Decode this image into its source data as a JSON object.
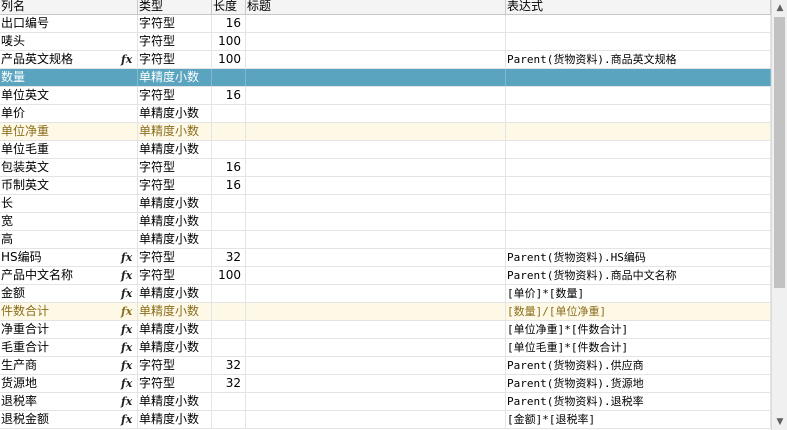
{
  "columns": [
    "列名",
    "类型",
    "长度",
    "标题",
    "表达式"
  ],
  "rows": [
    {
      "name": "出口编号",
      "type": "字符型",
      "length": "16",
      "title": "",
      "expr": "",
      "fx": false,
      "state": ""
    },
    {
      "name": "唛头",
      "type": "字符型",
      "length": "100",
      "title": "",
      "expr": "",
      "fx": false,
      "state": ""
    },
    {
      "name": "产品英文规格",
      "type": "字符型",
      "length": "100",
      "title": "",
      "expr": "Parent(货物资料).商品英文规格",
      "fx": true,
      "state": ""
    },
    {
      "name": "数量",
      "type": "单精度小数",
      "length": "",
      "title": "",
      "expr": "",
      "fx": false,
      "state": "sel"
    },
    {
      "name": "单位英文",
      "type": "字符型",
      "length": "16",
      "title": "",
      "expr": "",
      "fx": false,
      "state": ""
    },
    {
      "name": "单价",
      "type": "单精度小数",
      "length": "",
      "title": "",
      "expr": "",
      "fx": false,
      "state": ""
    },
    {
      "name": "单位净重",
      "type": "单精度小数",
      "length": "",
      "title": "",
      "expr": "",
      "fx": false,
      "state": "alt"
    },
    {
      "name": "单位毛重",
      "type": "单精度小数",
      "length": "",
      "title": "",
      "expr": "",
      "fx": false,
      "state": ""
    },
    {
      "name": "包装英文",
      "type": "字符型",
      "length": "16",
      "title": "",
      "expr": "",
      "fx": false,
      "state": ""
    },
    {
      "name": "币制英文",
      "type": "字符型",
      "length": "16",
      "title": "",
      "expr": "",
      "fx": false,
      "state": ""
    },
    {
      "name": "长",
      "type": "单精度小数",
      "length": "",
      "title": "",
      "expr": "",
      "fx": false,
      "state": ""
    },
    {
      "name": "宽",
      "type": "单精度小数",
      "length": "",
      "title": "",
      "expr": "",
      "fx": false,
      "state": ""
    },
    {
      "name": "高",
      "type": "单精度小数",
      "length": "",
      "title": "",
      "expr": "",
      "fx": false,
      "state": ""
    },
    {
      "name": "HS编码",
      "type": "字符型",
      "length": "32",
      "title": "",
      "expr": "Parent(货物资料).HS编码",
      "fx": true,
      "state": ""
    },
    {
      "name": "产品中文名称",
      "type": "字符型",
      "length": "100",
      "title": "",
      "expr": "Parent(货物资料).商品中文名称",
      "fx": true,
      "state": ""
    },
    {
      "name": "金额",
      "type": "单精度小数",
      "length": "",
      "title": "",
      "expr": "[单价]*[数量]",
      "fx": true,
      "state": ""
    },
    {
      "name": "件数合计",
      "type": "单精度小数",
      "length": "",
      "title": "",
      "expr": "[数量]/[单位净重]",
      "fx": true,
      "state": "alt"
    },
    {
      "name": "净重合计",
      "type": "单精度小数",
      "length": "",
      "title": "",
      "expr": "[单位净重]*[件数合计]",
      "fx": true,
      "state": ""
    },
    {
      "name": "毛重合计",
      "type": "单精度小数",
      "length": "",
      "title": "",
      "expr": "[单位毛重]*[件数合计]",
      "fx": true,
      "state": ""
    },
    {
      "name": "生产商",
      "type": "字符型",
      "length": "32",
      "title": "",
      "expr": "Parent(货物资料).供应商",
      "fx": true,
      "state": ""
    },
    {
      "name": "货源地",
      "type": "字符型",
      "length": "32",
      "title": "",
      "expr": "Parent(货物资料).货源地",
      "fx": true,
      "state": ""
    },
    {
      "name": "退税率",
      "type": "单精度小数",
      "length": "",
      "title": "",
      "expr": "Parent(货物资料).退税率",
      "fx": true,
      "state": ""
    },
    {
      "name": "退税金额",
      "type": "单精度小数",
      "length": "",
      "title": "",
      "expr": "[金额]*[退税率]",
      "fx": true,
      "state": ""
    }
  ],
  "fx_glyph": "fx",
  "scrollbar": {
    "up_glyph": "▲",
    "down_glyph": "▼",
    "position": 0.0,
    "visible_fraction": 0.68
  }
}
